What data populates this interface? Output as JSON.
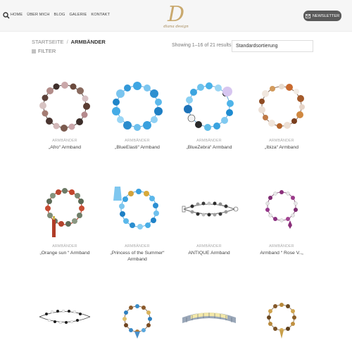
{
  "header": {
    "nav": [
      "HOME",
      "ÜBER MICH",
      "BLOG",
      "GALERIE",
      "KONTAKT"
    ],
    "logo_letter": "D",
    "logo_tagline": "diana design",
    "newsletter_label": "NEWSLETTER"
  },
  "breadcrumb": {
    "home": "STARTSEITE",
    "separator": "/",
    "current": "ARMBÄNDER"
  },
  "filter_label": "FILTER",
  "result_count": "Showing 1–16 of 21 results",
  "sort": {
    "selected": "Standardsortierung"
  },
  "products": [
    {
      "category": "ARMBÄNDER",
      "title": "„Afro“ Armband"
    },
    {
      "category": "ARMBÄNDER",
      "title": "„BlueElasti“ Armband"
    },
    {
      "category": "ARMBÄNDER",
      "title": "„BlueZebra“ Armband"
    },
    {
      "category": "ARMBÄNDER",
      "title": "„Ibiza“ Armband"
    },
    {
      "category": "ARMBÄNDER",
      "title": "„Orange sun “ Armband"
    },
    {
      "category": "ARMBÄNDER",
      "title": "„Princess of the Summer“ Armband"
    },
    {
      "category": "ARMBÄNDER",
      "title": "ANTIQUE Armband"
    },
    {
      "category": "ARMBÄNDER",
      "title": "Armband “ Rose V..„"
    },
    {
      "category": "",
      "title": ""
    },
    {
      "category": "",
      "title": ""
    },
    {
      "category": "",
      "title": ""
    },
    {
      "category": "",
      "title": ""
    }
  ],
  "colors": {
    "header_bg": "#f6f6f6",
    "newsletter_bg": "#5a5a5a",
    "logo_gold": "#c9a96e"
  }
}
